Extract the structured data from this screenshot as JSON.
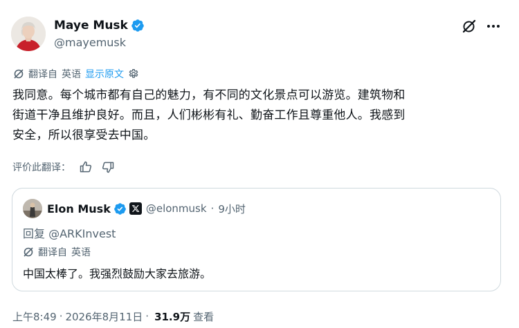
{
  "author": {
    "display_name": "Maye Musk",
    "handle": "@mayemusk",
    "verified_color": "#1d9bf0"
  },
  "header_icons": {
    "grok": "grok-icon",
    "more": "more-icon"
  },
  "translation": {
    "label": "翻译自",
    "source_lang": "英语",
    "show_original": "显示原文",
    "settings_icon": "gear-icon"
  },
  "tweet": {
    "lines": [
      "我同意。每个城市都有自己的魅力，有不同的文化景点可以游览。建筑物和",
      "街道干净且维护良好。而且，人们彬彬有礼、勤奋工作且尊重他人。我感到",
      "安全，所以很享受去中国。"
    ]
  },
  "rating": {
    "label": "评价此翻译：",
    "up_icon": "thumbs-up-icon",
    "down_icon": "thumbs-down-icon"
  },
  "quote": {
    "display_name": "Elon Musk",
    "handle": "@elonmusk",
    "separator": "·",
    "time": "9小时",
    "reply_to": "回复 @ARKInvest",
    "translation_label": "翻译自",
    "source_lang": "英语",
    "text": "中国太棒了。我强烈鼓励大家去旅游。"
  },
  "footer": {
    "time": "上午8:49",
    "sep1": "·",
    "date": "2026年8月11日",
    "sep2": "·",
    "views_count": "31.9万",
    "views_label": "查看"
  },
  "colors": {
    "text": "#0f1419",
    "secondary": "#536471",
    "accent": "#1d9bf0",
    "border": "#cfd9de"
  }
}
